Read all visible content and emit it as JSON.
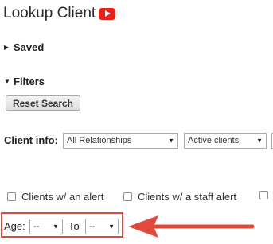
{
  "header": {
    "title": "Lookup Client",
    "video_icon": "youtube-play-icon"
  },
  "sections": {
    "saved_label": "Saved",
    "filters_label": "Filters"
  },
  "actions": {
    "reset_label": "Reset Search"
  },
  "client_info": {
    "label": "Client info:",
    "relationship_selected": "All Relationships",
    "status_selected": "Active clients"
  },
  "alerts": {
    "alert_label": "Clients w/ an alert",
    "staff_alert_label": "Clients w/ a staff alert"
  },
  "age_filter": {
    "label": "Age:",
    "from_selected": "--",
    "to_label": "To",
    "to_selected": "--"
  },
  "annotation": {
    "highlight_color": "#e04a3d",
    "arrow_color": "#e04a3d"
  }
}
